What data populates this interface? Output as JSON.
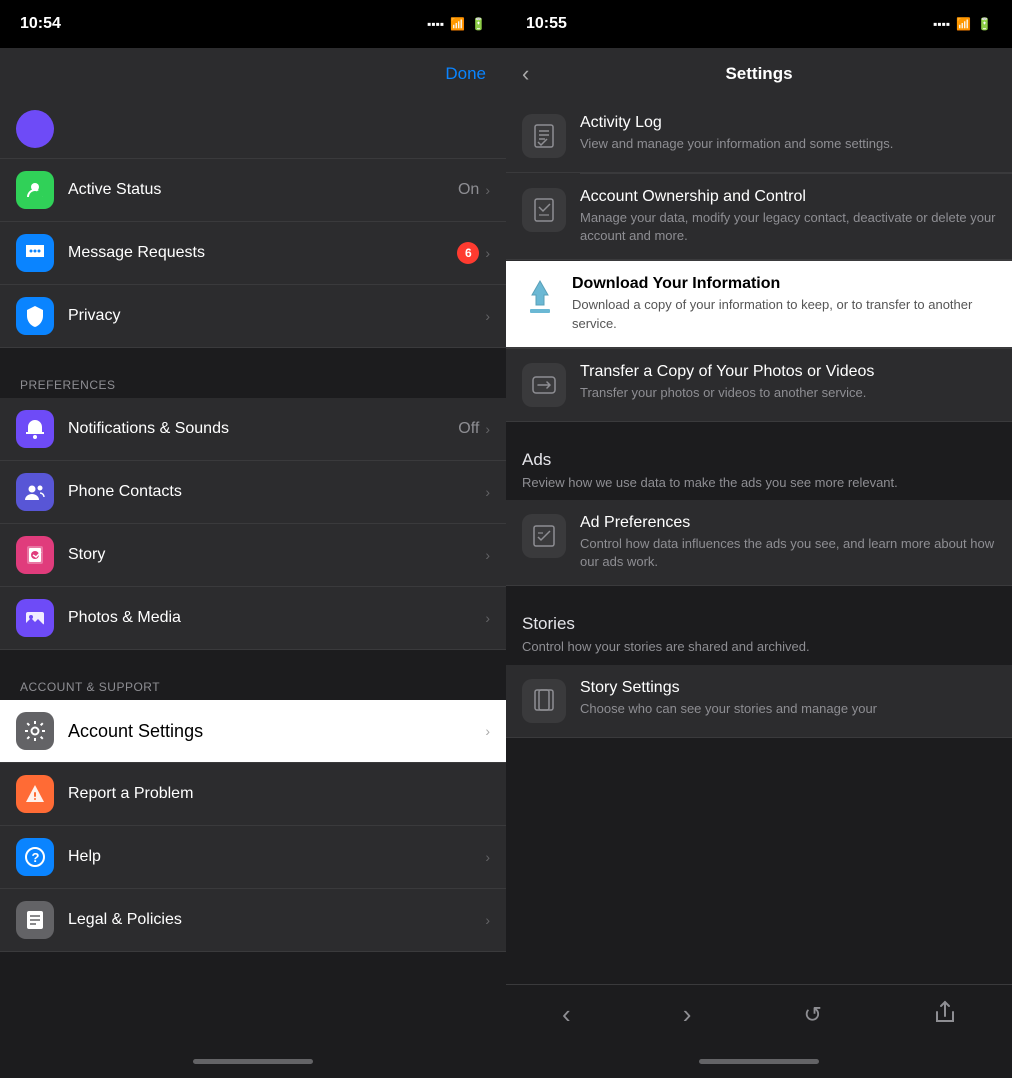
{
  "left": {
    "status_time": "10:54",
    "done_label": "Done",
    "items": [
      {
        "id": "active-status",
        "icon_class": "icon-green",
        "icon_symbol": "●",
        "label": "Active Status",
        "value": "On",
        "has_chevron": true,
        "badge": null,
        "highlighted": false
      },
      {
        "id": "message-requests",
        "icon_class": "icon-blue-msg",
        "icon_symbol": "💬",
        "label": "Message Requests",
        "value": null,
        "has_chevron": true,
        "badge": "6",
        "highlighted": false
      },
      {
        "id": "privacy",
        "icon_class": "icon-blue-dark",
        "icon_symbol": "🛡",
        "label": "Privacy",
        "value": null,
        "has_chevron": true,
        "badge": null,
        "highlighted": false
      }
    ],
    "section_preferences": "PREFERENCES",
    "preferences_items": [
      {
        "id": "notifications",
        "icon_class": "icon-purple-notif",
        "icon_symbol": "🔔",
        "label": "Notifications & Sounds",
        "value": "Off",
        "has_chevron": true,
        "badge": null,
        "highlighted": false
      },
      {
        "id": "phone-contacts",
        "icon_class": "icon-purple-contacts",
        "icon_symbol": "👥",
        "label": "Phone Contacts",
        "value": null,
        "has_chevron": true,
        "badge": null,
        "highlighted": false
      },
      {
        "id": "story",
        "icon_class": "icon-pink-story",
        "icon_symbol": "▶",
        "label": "Story",
        "value": null,
        "has_chevron": true,
        "badge": null,
        "highlighted": false
      },
      {
        "id": "photos-media",
        "icon_class": "icon-purple-photo",
        "icon_symbol": "🖼",
        "label": "Photos & Media",
        "value": null,
        "has_chevron": true,
        "badge": null,
        "highlighted": false
      }
    ],
    "section_account": "ACCOUNT & SUPPORT",
    "account_items": [
      {
        "id": "account-settings",
        "icon_class": "icon-gray",
        "icon_symbol": "⚙",
        "label": "Account Settings",
        "value": null,
        "has_chevron": true,
        "badge": null,
        "highlighted": true
      },
      {
        "id": "report-problem",
        "icon_class": "icon-orange",
        "icon_symbol": "⚠",
        "label": "Report a Problem",
        "value": null,
        "has_chevron": false,
        "badge": null,
        "highlighted": false
      },
      {
        "id": "help",
        "icon_class": "icon-blue-help",
        "icon_symbol": "?",
        "label": "Help",
        "value": null,
        "has_chevron": true,
        "badge": null,
        "highlighted": false
      },
      {
        "id": "legal",
        "icon_class": "icon-gray-legal",
        "icon_symbol": "📄",
        "label": "Legal & Policies",
        "value": null,
        "has_chevron": true,
        "badge": null,
        "highlighted": false
      }
    ]
  },
  "right": {
    "status_time": "10:55",
    "nav_title": "Settings",
    "back_symbol": "‹",
    "settings_groups": [
      {
        "id": "your-info-group",
        "items": [
          {
            "id": "activity-log",
            "icon_symbol": "📋",
            "title": "Activity Log",
            "subtitle": "View and manage your information and some settings.",
            "highlighted": false
          },
          {
            "id": "account-ownership",
            "icon_symbol": "📝",
            "title": "Account Ownership and Control",
            "subtitle": "Manage your data, modify your legacy contact, deactivate or delete your account and more.",
            "highlighted": false
          },
          {
            "id": "download-info",
            "icon_symbol": "⬇",
            "title": "Download Your Information",
            "subtitle": "Download a copy of your information to keep, or to transfer to another service.",
            "highlighted": true
          },
          {
            "id": "transfer-photos",
            "icon_symbol": "⇄",
            "title": "Transfer a Copy of Your Photos or Videos",
            "subtitle": "Transfer your photos or videos to another service.",
            "highlighted": false
          }
        ]
      },
      {
        "id": "ads-group",
        "section_title": "Ads",
        "section_subtitle": "Review how we use data to make the ads you see more relevant.",
        "items": [
          {
            "id": "ad-preferences",
            "icon_symbol": "☑",
            "title": "Ad Preferences",
            "subtitle": "Control how data influences the ads you see, and learn more about how our ads work.",
            "highlighted": false
          }
        ]
      },
      {
        "id": "stories-group",
        "section_title": "Stories",
        "section_subtitle": "Control how your stories are shared and archived.",
        "items": [
          {
            "id": "story-settings",
            "icon_symbol": "📖",
            "title": "Story Settings",
            "subtitle": "Choose who can see your stories and manage your",
            "highlighted": false
          }
        ]
      }
    ],
    "bottom_nav": {
      "back": "‹",
      "forward": "›",
      "refresh": "↺",
      "share": "⬆"
    }
  }
}
